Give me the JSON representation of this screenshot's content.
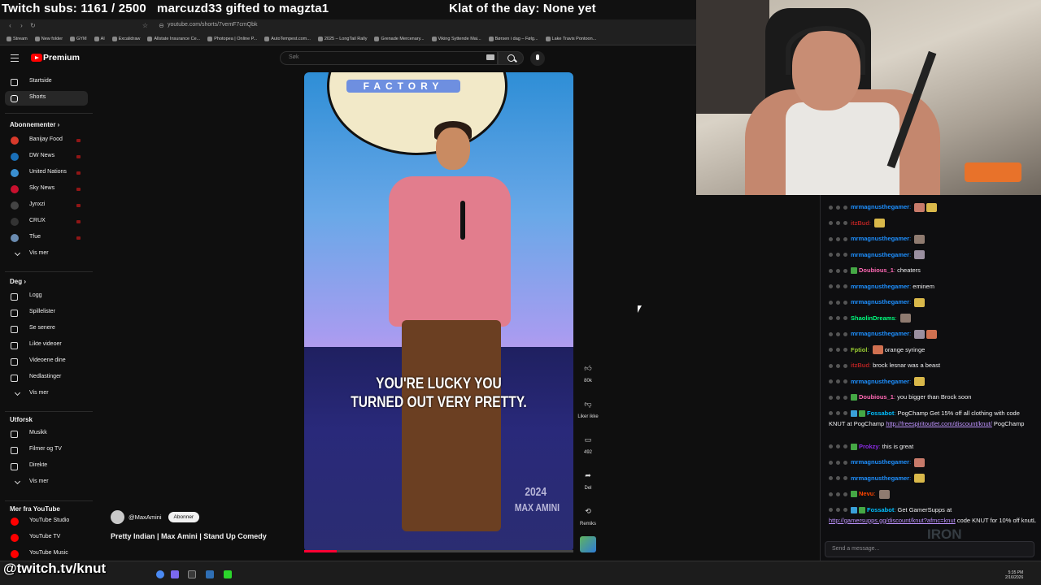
{
  "overlay": {
    "subs_text": "Twitch subs: 1161 / 2500",
    "gift_text": "marcuzd33 gifted to magzta1",
    "klat_text": "Klat of the day: None yet",
    "twitch_tag": "@twitch.tv/knut"
  },
  "browser": {
    "url": "youtube.com/shorts/7vemF7cmQbk",
    "bookmarks": [
      "Stream",
      "New folder",
      "GYM",
      "AI",
      "Excalidraw",
      "Allstate Insurance Ce...",
      "Photopea | Online P...",
      "AutoTempest.com...",
      "2025 – LongTail Rally",
      "Grenade Mercenary...",
      "Viking Syttende Mai...",
      "Børsen i dag – Følg...",
      "Lake Travis Pontoon..."
    ]
  },
  "youtube": {
    "brand": "Premium",
    "search_placeholder": "Søk",
    "sidebar": {
      "main": [
        {
          "label": "Startside",
          "icon": "home-icon"
        },
        {
          "label": "Shorts",
          "icon": "shorts-icon",
          "active": true
        }
      ],
      "subs_header": "Abonnementer",
      "subs": [
        {
          "label": "Banijay Food",
          "color": "#d93a2b"
        },
        {
          "label": "DW News",
          "color": "#1a6fb8"
        },
        {
          "label": "United Nations",
          "color": "#3a8fd0"
        },
        {
          "label": "Sky News",
          "color": "#c8102e"
        },
        {
          "label": "Jynxzi",
          "color": "#444444"
        },
        {
          "label": "CRUX",
          "color": "#333333"
        },
        {
          "label": "Tfue",
          "color": "#6a8bb0"
        }
      ],
      "subs_more": "Vis mer",
      "you_header": "Deg",
      "you": [
        {
          "label": "Logg",
          "icon": "history-icon"
        },
        {
          "label": "Spillelister",
          "icon": "playlist-icon"
        },
        {
          "label": "Se senere",
          "icon": "clock-icon"
        },
        {
          "label": "Likte videoer",
          "icon": "like-icon"
        },
        {
          "label": "Videoene dine",
          "icon": "video-icon"
        },
        {
          "label": "Nedlastinger",
          "icon": "download-icon"
        }
      ],
      "you_more": "Vis mer",
      "explore_header": "Utforsk",
      "explore": [
        {
          "label": "Musikk",
          "icon": "music-icon"
        },
        {
          "label": "Filmer og TV",
          "icon": "film-icon"
        },
        {
          "label": "Direkte",
          "icon": "live-icon"
        }
      ],
      "explore_more": "Vis mer",
      "more_header": "Mer fra YouTube",
      "more": [
        {
          "label": "YouTube Studio",
          "color": "#ff0000"
        },
        {
          "label": "YouTube TV",
          "color": "#ff0000"
        },
        {
          "label": "YouTube Music",
          "color": "#ff0000"
        }
      ]
    },
    "short": {
      "sign_text": "FACTORY",
      "caption_line1": "YOU'RE LUCKY YOU",
      "caption_line2": "TURNED OUT VERY PRETTY.",
      "watermark_year": "2024",
      "watermark_name": "MAX AMINI",
      "progress": 0.12,
      "channel": "@MaxAmini",
      "subscribe_label": "Abonner",
      "title": "Pretty Indian | Max Amini | Stand Up Comedy",
      "actions": {
        "like_count": "80k",
        "dislike_label": "Liker ikke",
        "comment_count": "492",
        "share_label": "Del",
        "remix_label": "Remiks"
      }
    }
  },
  "chat": {
    "input_placeholder": "Send a message...",
    "logo_text": "IRON",
    "messages": [
      {
        "user": "mrmagnusthegamer",
        "color": "#1e90ff",
        "text": "",
        "emotes": 2
      },
      {
        "user": "itzBud",
        "color": "#b22222",
        "text": "",
        "emotes": 1
      },
      {
        "user": "mrmagnusthegamer",
        "color": "#1e90ff",
        "text": "",
        "emotes": 1
      },
      {
        "user": "mrmagnusthegamer",
        "color": "#1e90ff",
        "text": "",
        "emotes": 1
      },
      {
        "user": "Doubious_1",
        "color": "#ff69b4",
        "text": "cheaters",
        "emotes": 0
      },
      {
        "user": "mrmagnusthegamer",
        "color": "#1e90ff",
        "text": "eminem",
        "emotes": 0
      },
      {
        "user": "mrmagnusthegamer",
        "color": "#1e90ff",
        "text": "",
        "emotes": 1
      },
      {
        "user": "ShaolinDreams",
        "color": "#00ff7f",
        "text": "",
        "emotes": 1
      },
      {
        "user": "mrmagnusthegamer",
        "color": "#1e90ff",
        "text": "",
        "emotes": 2
      },
      {
        "user": "Fptiol",
        "color": "#9acd32",
        "text": "orange syringe",
        "emotes": 1
      },
      {
        "user": "itzBud",
        "color": "#b22222",
        "text": "brock lesnar was a beast",
        "emotes": 0
      },
      {
        "user": "mrmagnusthegamer",
        "color": "#1e90ff",
        "text": "",
        "emotes": 1
      },
      {
        "user": "Doubious_1",
        "color": "#ff69b4",
        "text": "you bigger than Brock soon",
        "emotes": 0
      },
      {
        "user": "Fossabot",
        "color": "#00bfff",
        "text": "PogChamp Get 15% off all clothing with code KNUT at PogChamp",
        "link": "http://freespiritoutlet.com/discount/knut/",
        "after": "PogChamp",
        "emotes": 0
      },
      {
        "user": "Prokzy",
        "color": "#8a2be2",
        "text": "this is great",
        "emotes": 0
      },
      {
        "user": "mrmagnusthegamer",
        "color": "#1e90ff",
        "text": "",
        "emotes": 1
      },
      {
        "user": "mrmagnusthegamer",
        "color": "#1e90ff",
        "text": "",
        "emotes": 1
      },
      {
        "user": "Nevu",
        "color": "#ff4500",
        "text": "",
        "emotes": 1
      },
      {
        "user": "Fossabot",
        "color": "#00bfff",
        "text": "Get GamerSupps at",
        "link": "http://gamersupps.gg/discount/knut?afmc=knut",
        "after": "code KNUT for 10% off knutL",
        "emotes": 0
      }
    ]
  },
  "taskbar": {
    "time": "5:35 PM",
    "date": "2/16/2026"
  }
}
